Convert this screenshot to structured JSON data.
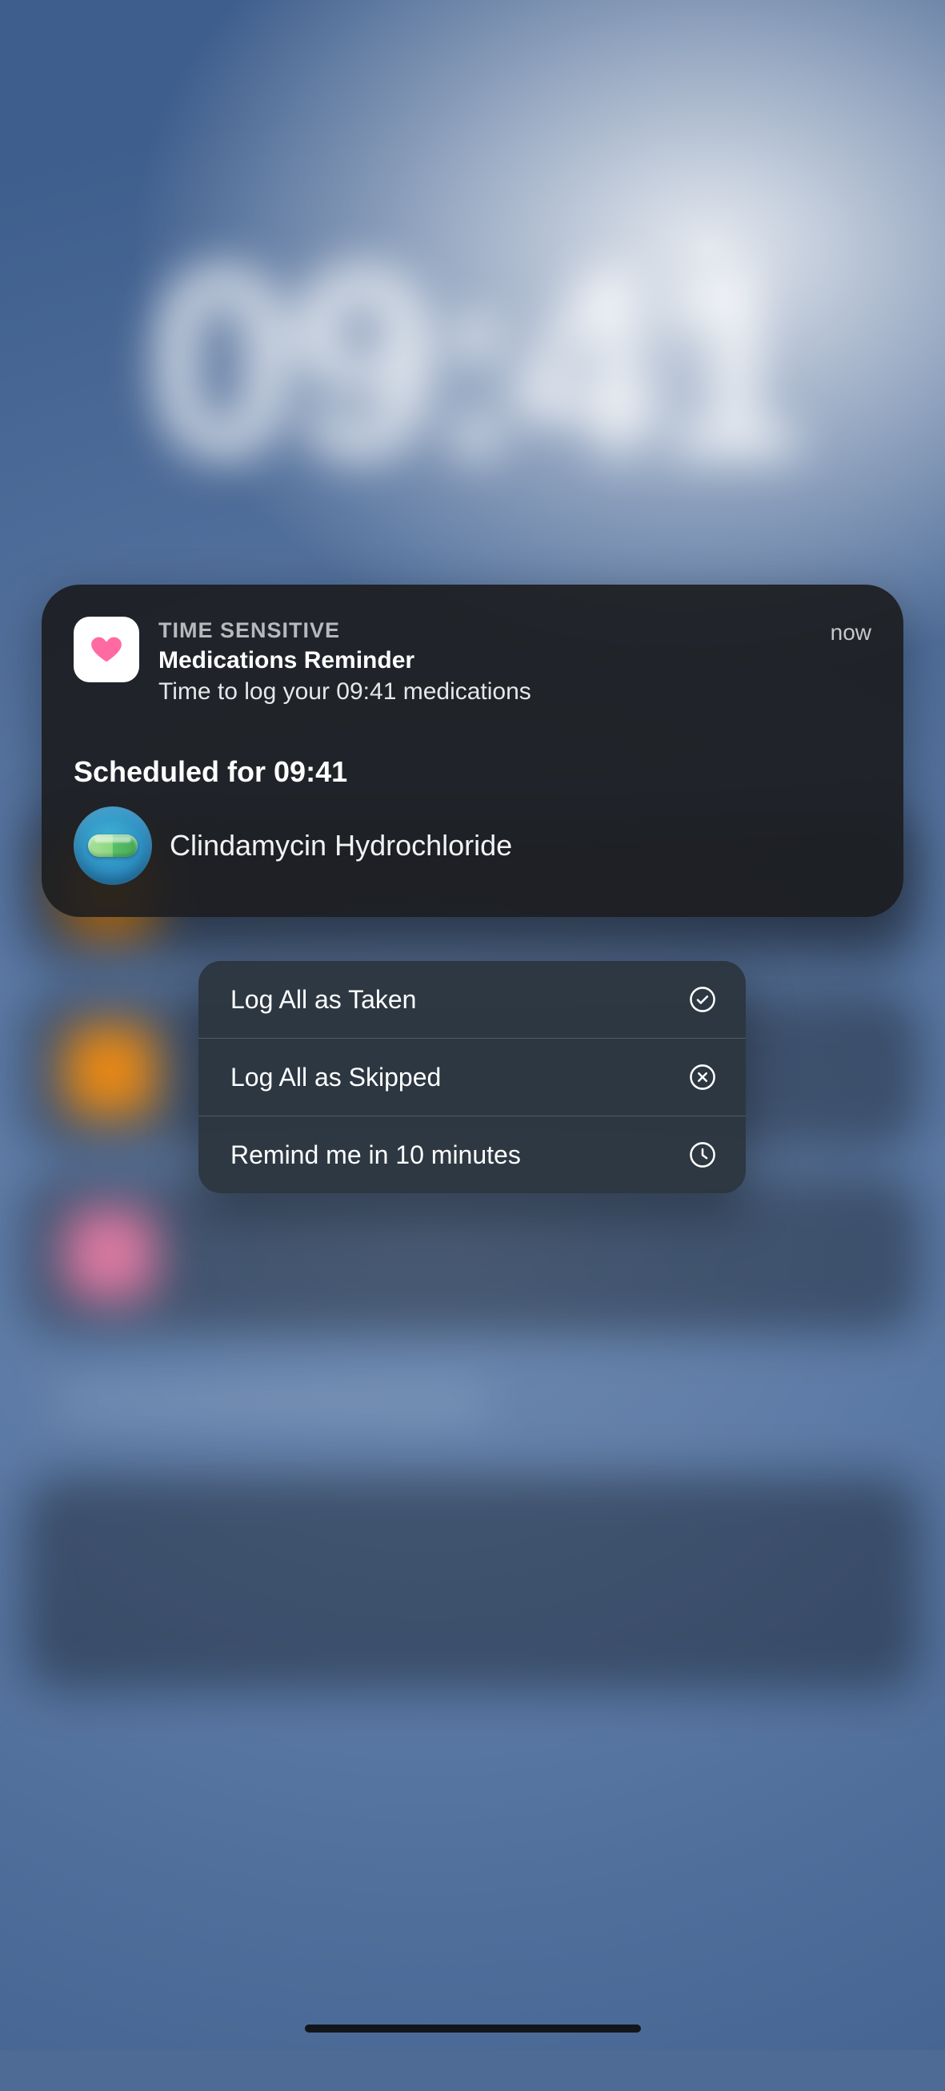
{
  "background": {
    "time": "09:41"
  },
  "notification": {
    "tag": "TIME SENSITIVE",
    "title": "Medications Reminder",
    "body": "Time to log your 09:41 medications",
    "timestamp": "now",
    "scheduled_label": "Scheduled for 09:41",
    "medications": [
      {
        "name": "Clindamycin Hydrochloride"
      }
    ]
  },
  "actions": {
    "items": [
      {
        "label": "Log All as Taken",
        "icon": "checkmark-circle-icon"
      },
      {
        "label": "Log All as Skipped",
        "icon": "xmark-circle-icon"
      },
      {
        "label": "Remind me in 10 minutes",
        "icon": "clock-icon"
      }
    ]
  },
  "colors": {
    "notification_bg": "#1b1c1e",
    "menu_bg": "#2c3640",
    "heart": "#ff3b5c",
    "med_chip": "#2d8fc3",
    "capsule_light": "#8dd67f",
    "capsule_dark": "#45a856"
  }
}
